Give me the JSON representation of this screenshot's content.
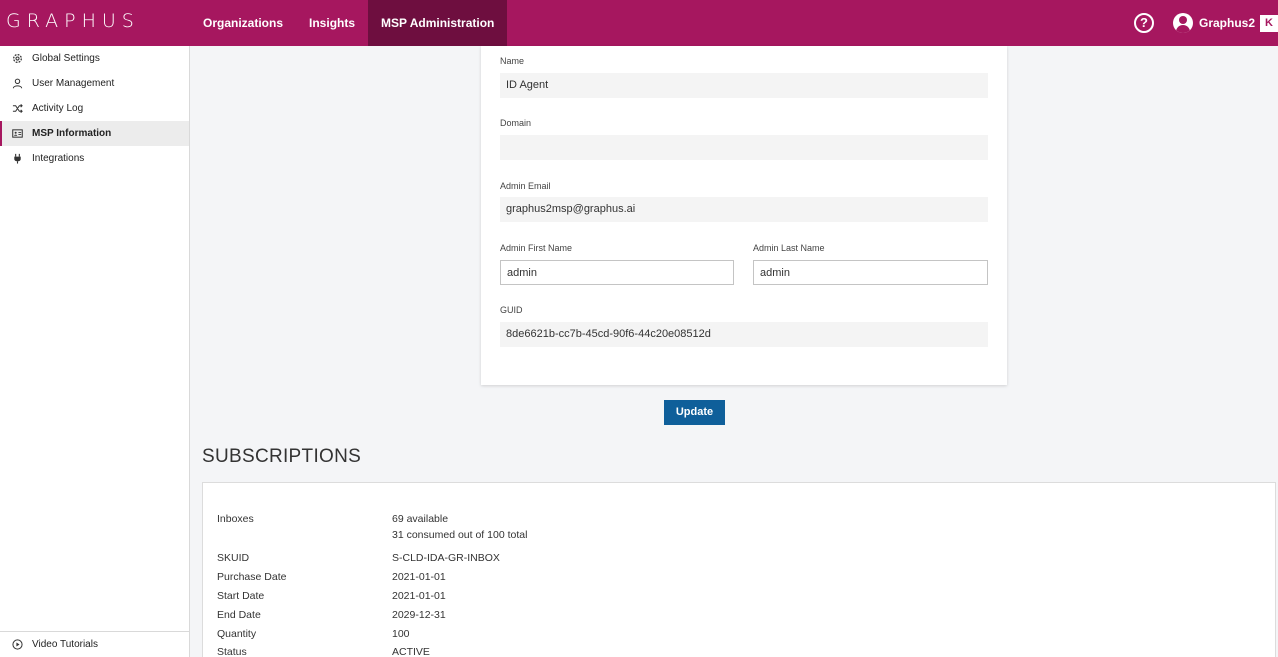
{
  "header": {
    "logo_text": "GRAPHUS",
    "nav": [
      {
        "label": "Organizations"
      },
      {
        "label": "Insights"
      },
      {
        "label": "MSP Administration"
      }
    ],
    "user_name": "Graphus2",
    "brand_badge": "K",
    "help_icon": "?"
  },
  "sidebar": {
    "items": [
      {
        "label": "Global Settings",
        "icon": "gear-icon"
      },
      {
        "label": "User Management",
        "icon": "user-icon"
      },
      {
        "label": "Activity Log",
        "icon": "shuffle-icon"
      },
      {
        "label": "MSP Information",
        "icon": "id-card-icon"
      },
      {
        "label": "Integrations",
        "icon": "plug-icon"
      }
    ],
    "bottom_label": "Video Tutorials"
  },
  "form": {
    "name_label": "Name",
    "name_value": "ID Agent",
    "domain_label": "Domain",
    "domain_value": "",
    "admin_email_label": "Admin Email",
    "admin_email_value": "graphus2msp@graphus.ai",
    "first_name_label": "Admin First Name",
    "first_name_value": "admin",
    "last_name_label": "Admin Last Name",
    "last_name_value": "admin",
    "guid_label": "GUID",
    "guid_value": "8de6621b-cc7b-45cd-90f6-44c20e08512d",
    "update_label": "Update"
  },
  "subscriptions": {
    "title": "SUBSCRIPTIONS",
    "inboxes_label": "Inboxes",
    "inboxes_available": "69 available",
    "inboxes_consumed": "31 consumed out of 100 total",
    "skuid_label": "SKUID",
    "skuid_value": "S-CLD-IDA-GR-INBOX",
    "purchase_label": "Purchase Date",
    "purchase_value": "2021-01-01",
    "start_label": "Start Date",
    "start_value": "2021-01-01",
    "end_label": "End Date",
    "end_value": "2029-12-31",
    "quantity_label": "Quantity",
    "quantity_value": "100",
    "status_label": "Status",
    "status_value": "ACTIVE"
  },
  "colors": {
    "brand": "#a6175f",
    "nav_active": "#6e0e3f",
    "button": "#0f5f9a"
  }
}
